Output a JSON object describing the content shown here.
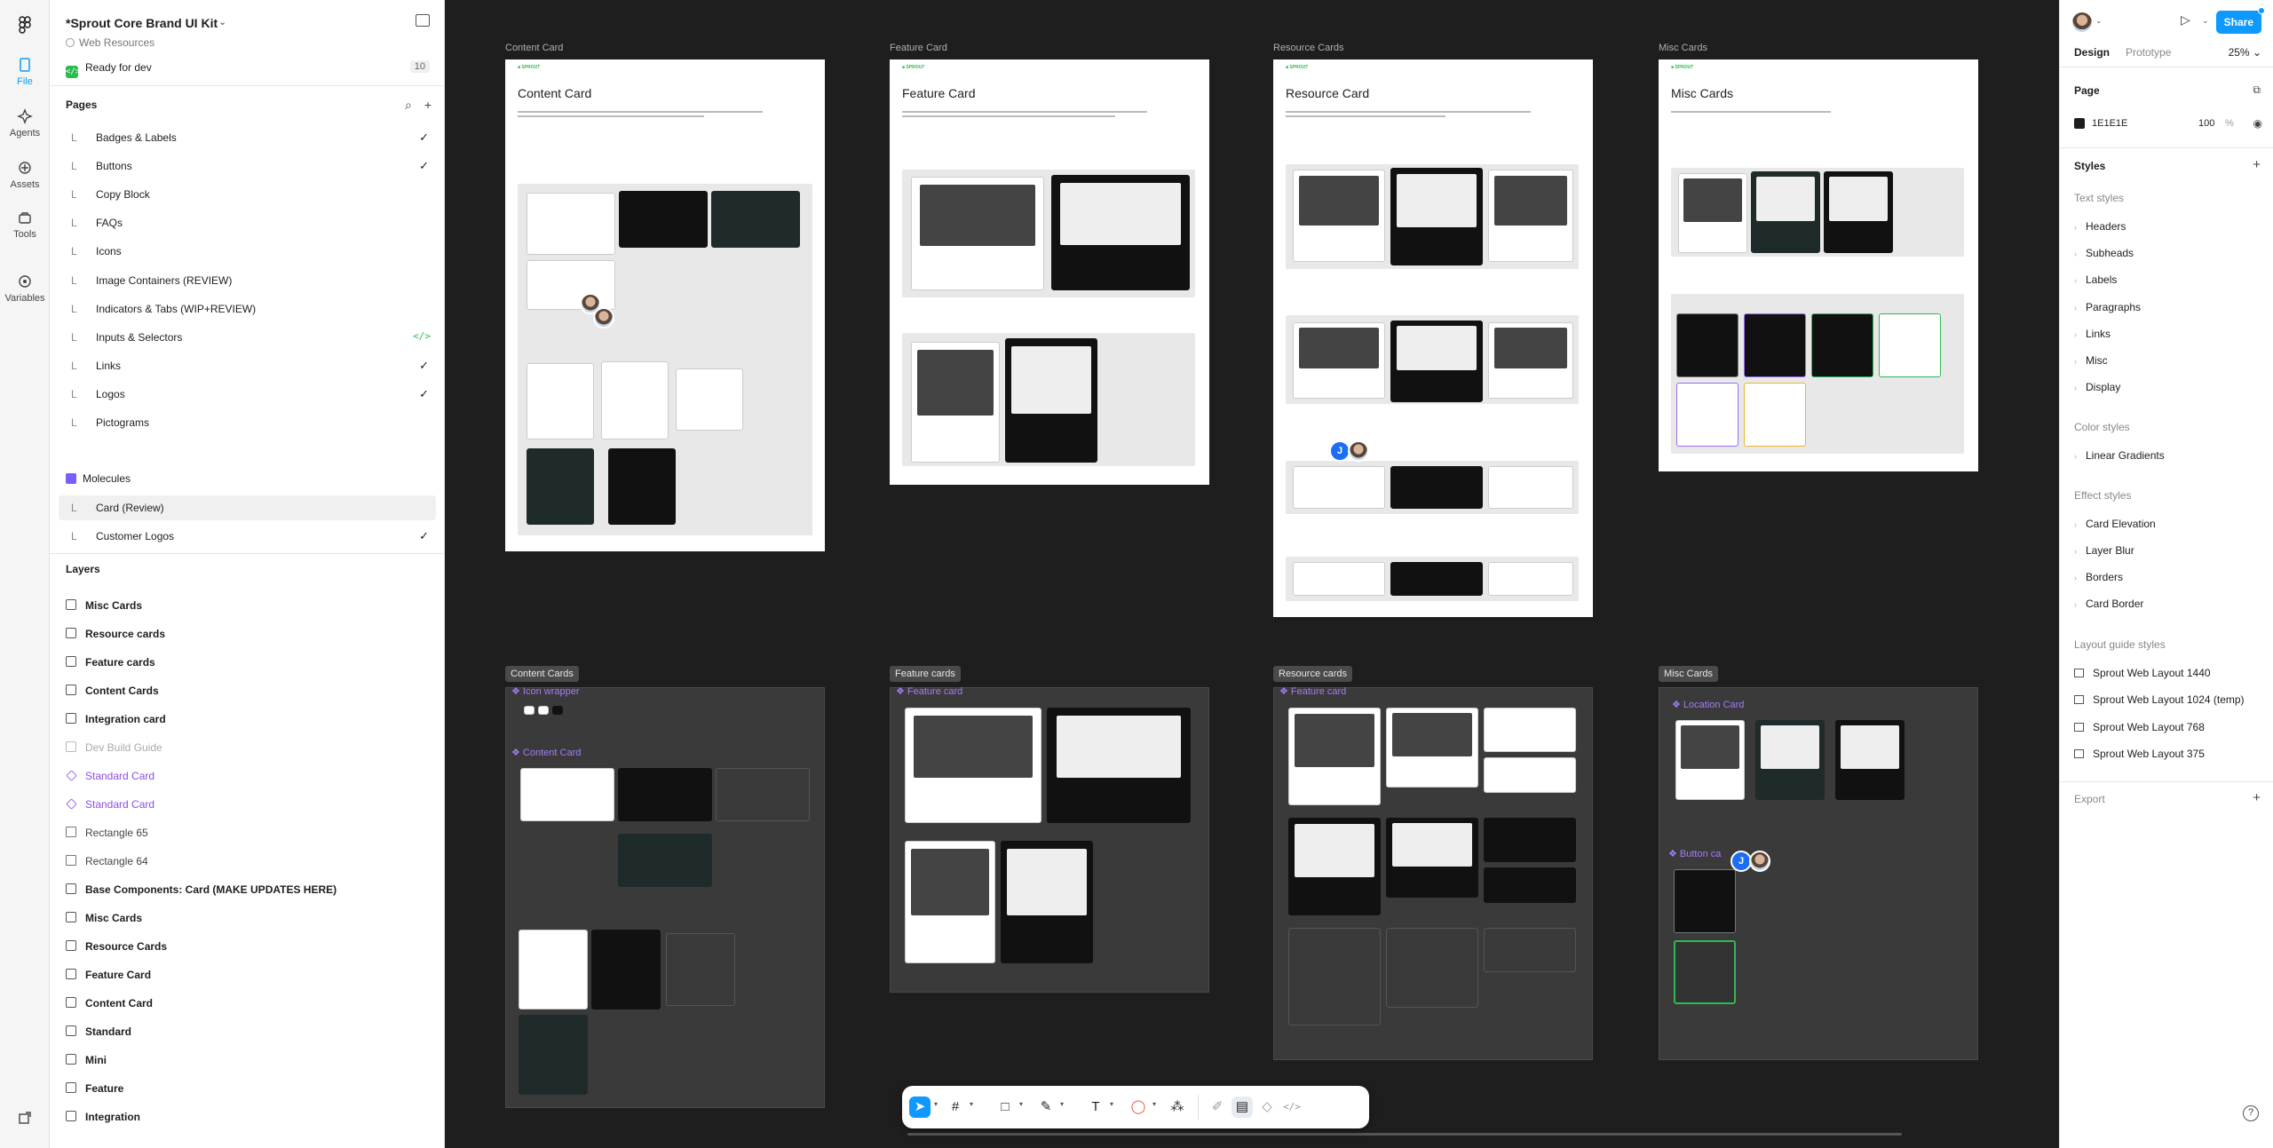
{
  "project": {
    "title": "*Sprout Core Brand UI Kit",
    "team": "Web Resources",
    "status": "Ready for dev",
    "status_count": "10"
  },
  "rail": {
    "file": "File",
    "agents": "Agents",
    "assets": "Assets",
    "tools": "Tools",
    "variables": "Variables"
  },
  "pages": {
    "title": "Pages",
    "items": [
      {
        "label": "Badges & Labels",
        "mark": "✓"
      },
      {
        "label": "Buttons",
        "mark": "✓"
      },
      {
        "label": "Copy Block",
        "mark": ""
      },
      {
        "label": "FAQs",
        "mark": ""
      },
      {
        "label": "Icons",
        "mark": ""
      },
      {
        "label": "Image Containers (REVIEW)",
        "mark": ""
      },
      {
        "label": "Indicators & Tabs (WIP+REVIEW)",
        "mark": ""
      },
      {
        "label": "Inputs & Selectors",
        "mark": "</>"
      },
      {
        "label": "Links",
        "mark": "✓"
      },
      {
        "label": "Logos",
        "mark": "✓"
      },
      {
        "label": "Pictograms",
        "mark": ""
      }
    ],
    "molecules_title": "Molecules",
    "molecules": [
      {
        "label": "Card (Review)",
        "mark": ""
      },
      {
        "label": "Customer Logos",
        "mark": "✓"
      }
    ]
  },
  "layers": {
    "title": "Layers",
    "items": [
      {
        "label": "Misc Cards",
        "kind": "grid",
        "style": "bold"
      },
      {
        "label": "Resource cards",
        "kind": "grid",
        "style": "bold"
      },
      {
        "label": "Feature cards",
        "kind": "grid",
        "style": "bold"
      },
      {
        "label": "Content Cards",
        "kind": "grid",
        "style": "bold"
      },
      {
        "label": "Integration card",
        "kind": "grid",
        "style": "bold"
      },
      {
        "label": "Dev Build Guide",
        "kind": "dim",
        "style": "dim"
      },
      {
        "label": "Standard Card",
        "kind": "comp",
        "style": "purple"
      },
      {
        "label": "Standard Card",
        "kind": "comp",
        "style": "purple"
      },
      {
        "label": "Rectangle 65",
        "kind": "rect",
        "style": "sub"
      },
      {
        "label": "Rectangle 64",
        "kind": "rect",
        "style": "sub"
      },
      {
        "label": "Base Components: Card (MAKE UPDATES HERE)",
        "kind": "grid",
        "style": "bold"
      },
      {
        "label": "Misc Cards",
        "kind": "grid",
        "style": "bold"
      },
      {
        "label": "Resource Cards",
        "kind": "grid",
        "style": "bold"
      },
      {
        "label": "Feature Card",
        "kind": "grid",
        "style": "bold"
      },
      {
        "label": "Content Card",
        "kind": "grid",
        "style": "bold"
      },
      {
        "label": "Standard",
        "kind": "grid",
        "style": "bold"
      },
      {
        "label": "Mini",
        "kind": "grid",
        "style": "bold"
      },
      {
        "label": "Feature",
        "kind": "grid",
        "style": "bold"
      },
      {
        "label": "Integration",
        "kind": "grid",
        "style": "bold"
      }
    ]
  },
  "canvas": {
    "top_frames": [
      {
        "label": "Content Card",
        "title": "Content Card"
      },
      {
        "label": "Feature Card",
        "title": "Feature Card"
      },
      {
        "label": "Resource Cards",
        "title": "Resource Card"
      },
      {
        "label": "Misc Cards",
        "title": "Misc Cards"
      }
    ],
    "bottom_sections": [
      {
        "label": "Content Cards"
      },
      {
        "label": "Feature cards"
      },
      {
        "label": "Resource cards"
      },
      {
        "label": "Misc Cards"
      }
    ],
    "component_labels": {
      "icon_wrapper": "Icon wrapper",
      "content_card": "Content Card",
      "feature_card_1": "Feature card",
      "feature_card_2": "Feature card",
      "location_card": "Location Card",
      "button_card": "Button ca"
    },
    "misc_location_label": "Location",
    "avatar_initial": "J"
  },
  "right": {
    "share": "Share",
    "tab_design": "Design",
    "tab_prototype": "Prototype",
    "zoom": "25%",
    "page_title": "Page",
    "page_color": "1E1E1E",
    "page_opacity": "100",
    "page_opacity_unit": "%",
    "styles_title": "Styles",
    "text_styles_title": "Text styles",
    "text_styles": [
      "Headers",
      "Subheads",
      "Labels",
      "Paragraphs",
      "Links",
      "Misc",
      "Display"
    ],
    "color_styles_title": "Color styles",
    "color_styles": [
      "Linear Gradients"
    ],
    "effect_styles_title": "Effect styles",
    "effect_styles": [
      "Card Elevation",
      "Layer Blur",
      "Borders",
      "Card Border"
    ],
    "layout_styles_title": "Layout guide styles",
    "layout_styles": [
      "Sprout Web Layout 1440",
      "Sprout Web Layout 1024 (temp)",
      "Sprout Web Layout 768",
      "Sprout Web Layout 375"
    ],
    "export_title": "Export",
    "help": "?"
  },
  "colors": {
    "accent": "#0d99ff",
    "component": "#8a4df0",
    "dev_green": "#2cbb4f",
    "canvas_bg": "#1e1e1e"
  }
}
